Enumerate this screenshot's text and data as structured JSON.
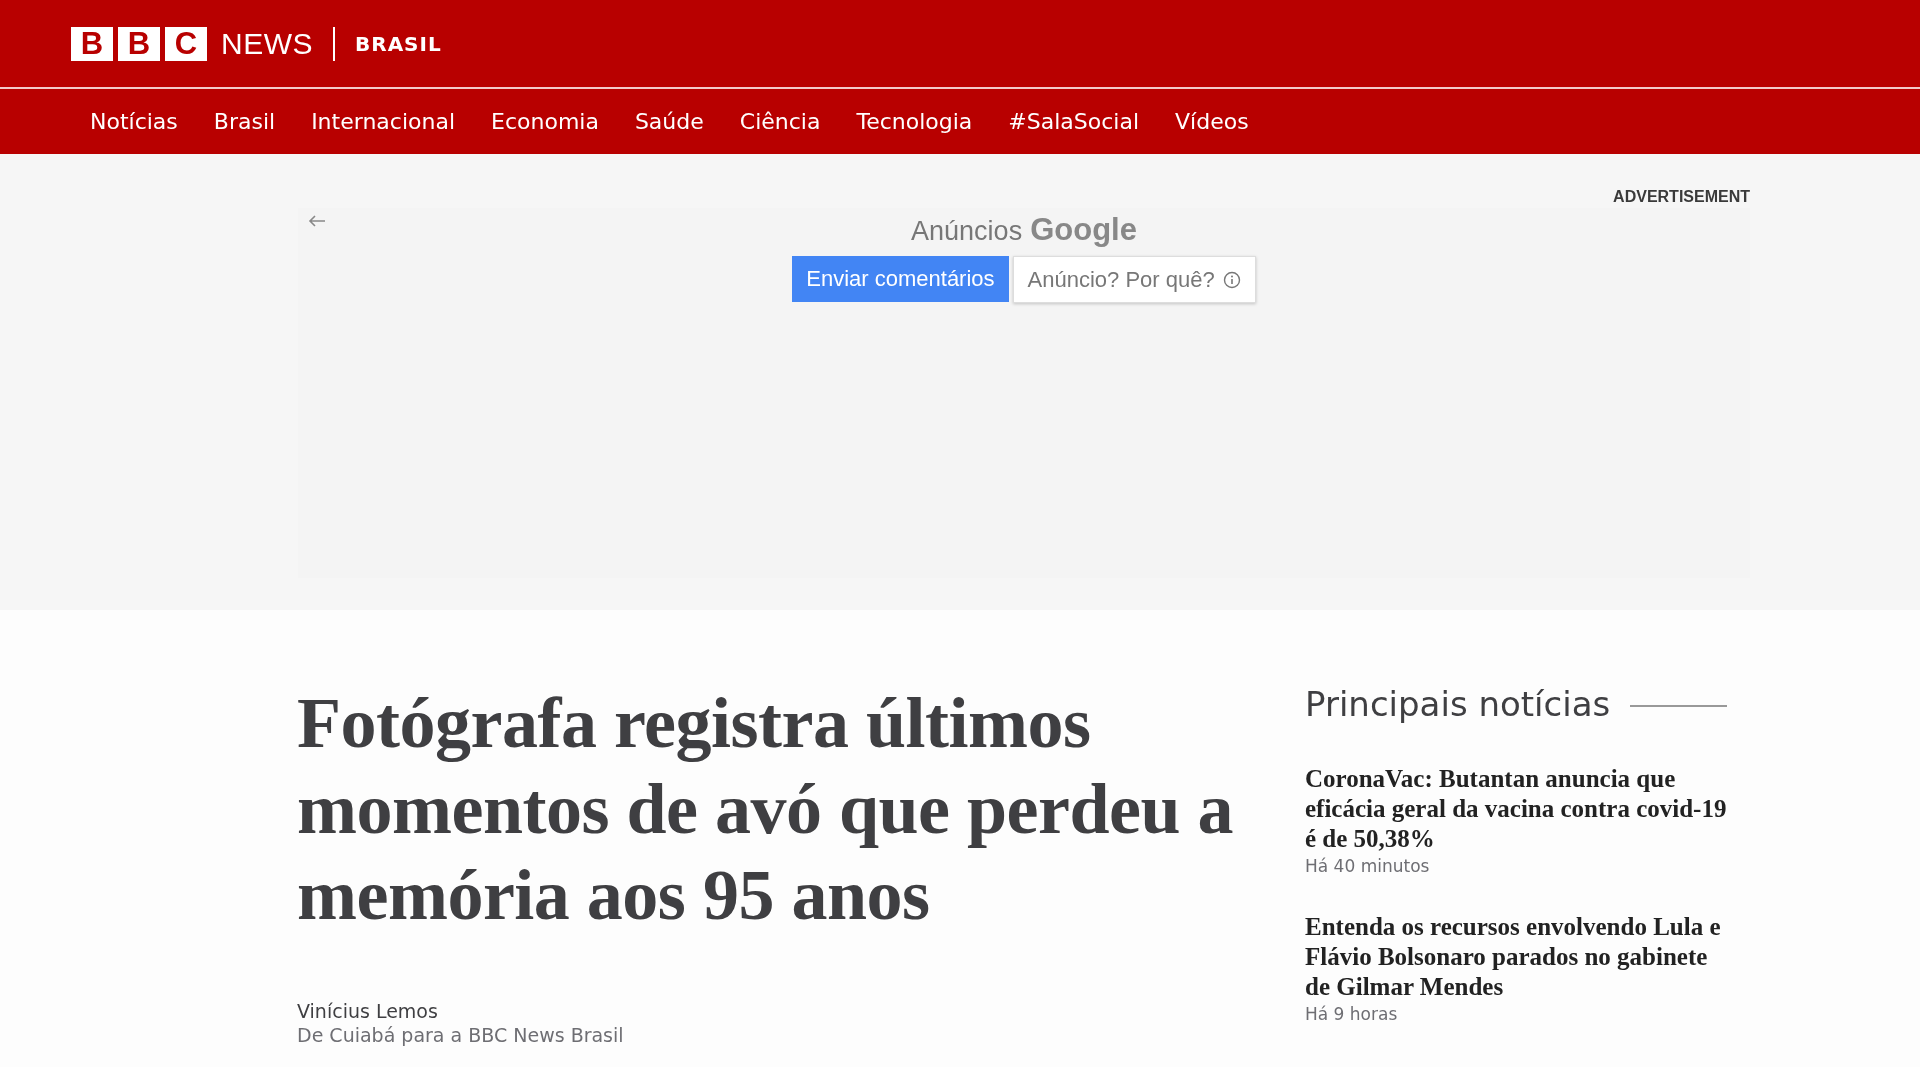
{
  "header": {
    "logo_letters": [
      "B",
      "B",
      "C"
    ],
    "logo_word": "NEWS",
    "edition": "BRASIL"
  },
  "nav": [
    "Notícias",
    "Brasil",
    "Internacional",
    "Economia",
    "Saúde",
    "Ciência",
    "Tecnologia",
    "#SalaSocial",
    "Vídeos"
  ],
  "ad": {
    "label": "ADVERTISEMENT",
    "ads_by": "Anúncios",
    "ads_brand": "Google",
    "feedback_button": "Enviar comentários",
    "why_button": "Anúncio? Por quê?"
  },
  "article": {
    "headline": "Fotógrafa registra últimos momentos de avó que perdeu a memória aos 95 anos",
    "author": "Vinícius Lemos",
    "byline": "De Cuiabá para a BBC News Brasil"
  },
  "sidebar": {
    "title": "Principais notícias",
    "stories": [
      {
        "headline": "CoronaVac: Butantan anuncia que eficácia geral da vacina contra covid-19 é de 50,38%",
        "time": "Há 40 minutos"
      },
      {
        "headline": "Entenda os recursos envolvendo Lula e Flávio Bolsonaro parados no gabinete de Gilmar Mendes",
        "time": "Há 9 horas"
      }
    ]
  }
}
